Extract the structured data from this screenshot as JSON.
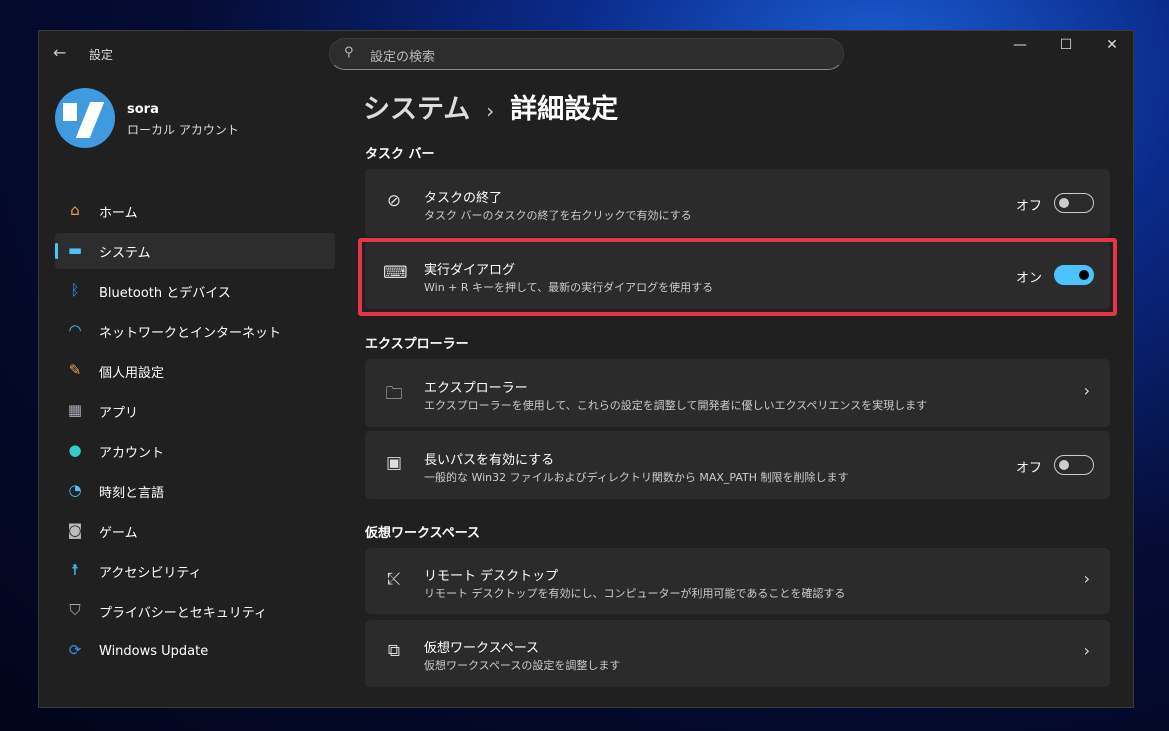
{
  "app": {
    "title": "設定",
    "search_placeholder": "設定の検索"
  },
  "user": {
    "name": "sora",
    "account_type": "ローカル アカウント"
  },
  "nav": [
    {
      "label": "ホーム",
      "icon": "home-icon"
    },
    {
      "label": "システム",
      "icon": "system-icon",
      "active": true
    },
    {
      "label": "Bluetooth とデバイス",
      "icon": "bluetooth-icon"
    },
    {
      "label": "ネットワークとインターネット",
      "icon": "wifi-icon"
    },
    {
      "label": "個人用設定",
      "icon": "brush-icon"
    },
    {
      "label": "アプリ",
      "icon": "apps-icon"
    },
    {
      "label": "アカウント",
      "icon": "account-icon"
    },
    {
      "label": "時刻と言語",
      "icon": "clock-globe-icon"
    },
    {
      "label": "ゲーム",
      "icon": "gamepad-icon"
    },
    {
      "label": "アクセシビリティ",
      "icon": "accessibility-icon"
    },
    {
      "label": "プライバシーとセキュリティ",
      "icon": "shield-icon"
    },
    {
      "label": "Windows Update",
      "icon": "update-icon"
    }
  ],
  "breadcrumb": {
    "parent": "システム",
    "current": "詳細設定"
  },
  "sections": {
    "taskbar": "タスク バー",
    "explorer": "エクスプローラー",
    "virtual": "仮想ワークスペース"
  },
  "cards": {
    "end_task": {
      "title": "タスクの終了",
      "subtitle": "タスク バーのタスクの終了を右クリックで有効にする",
      "state": "オフ",
      "on": false
    },
    "run_dialog": {
      "title": "実行ダイアログ",
      "subtitle": "Win + R キーを押して、最新の実行ダイアログを使用する",
      "state": "オン",
      "on": true
    },
    "explorer": {
      "title": "エクスプローラー",
      "subtitle": "エクスプローラーを使用して、これらの設定を調整して開発者に優しいエクスペリエンスを実現します"
    },
    "long_paths": {
      "title": "長いパスを有効にする",
      "subtitle": "一般的な Win32 ファイルおよびディレクトリ関数から MAX_PATH 制限を削除します",
      "state": "オフ",
      "on": false
    },
    "remote_desktop": {
      "title": "リモート デスクトップ",
      "subtitle": "リモート デスクトップを有効にし、コンピューターが利用可能であることを確認する"
    },
    "virtual_ws": {
      "title": "仮想ワークスペース",
      "subtitle": "仮想ワークスペースの設定を調整します"
    }
  },
  "colors": {
    "accent": "#4cc2ff",
    "highlight": "#e8344a"
  }
}
